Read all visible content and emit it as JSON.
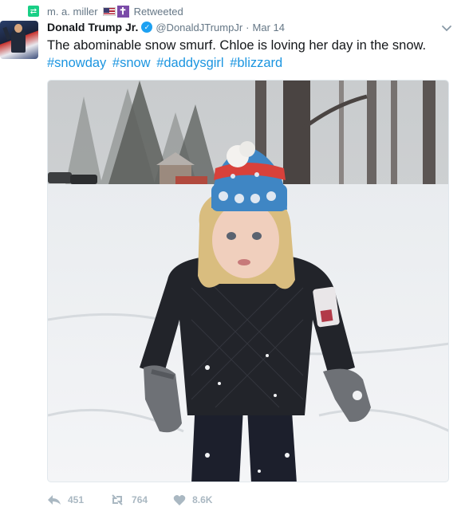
{
  "retweet_context": {
    "user_name": "m. a. miller",
    "label": "Retweeted"
  },
  "tweet": {
    "author_name": "Donald Trump Jr.",
    "handle": "@DonaldJTrumpJr",
    "separator": "·",
    "date": "Mar 14",
    "text": "The abominable snow smurf. Chloe is loving her day in the snow.",
    "hashtags": [
      "#snowday",
      "#snow",
      "#daddysgirl",
      "#blizzard"
    ]
  },
  "actions": {
    "reply_count": "451",
    "retweet_count": "764",
    "like_count": "8.6K"
  },
  "colors": {
    "retweet_green": "#19cf86",
    "link_blue": "#1b95e0",
    "verified_blue": "#1da1f2",
    "muted_gray": "#657786",
    "action_gray": "#aab8c2"
  },
  "icons": [
    "retweet-icon",
    "us-flag-icon",
    "cross-icon",
    "verified-badge-icon",
    "caret-down-icon",
    "reply-icon",
    "like-icon"
  ]
}
